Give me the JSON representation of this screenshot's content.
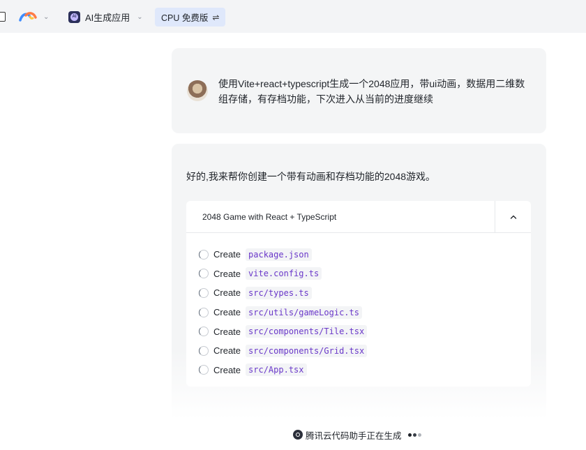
{
  "toolbar": {
    "app_name": "AI生成应用",
    "cpu_label": "CPU 免费版",
    "swap_symbol": "⇌"
  },
  "conversation": {
    "user_message": "使用Vite+react+typescript生成一个2048应用，带ui动画，数据用二维数组存储，有存档功能，下次进入从当前的进度继续",
    "assistant_intro": "好的,我来帮你创建一个带有动画和存档功能的2048游戏。",
    "task_panel": {
      "title": "2048 Game with React + TypeScript",
      "action_label": "Create",
      "files": [
        "package.json",
        "vite.config.ts",
        "src/types.ts",
        "src/utils/gameLogic.ts",
        "src/components/Tile.tsx",
        "src/components/Grid.tsx",
        "src/App.tsx"
      ]
    }
  },
  "status": {
    "text": "腾讯云代码助手正在生成"
  },
  "icons": {
    "logo": "colorful-arc-logo-icon",
    "app": "ai-app-icon",
    "collapse": "chevron-up-icon",
    "loading": "loading-spinner-icon"
  },
  "colors": {
    "code_text": "#6a38c9",
    "chip_background": "#dfe8fb"
  }
}
